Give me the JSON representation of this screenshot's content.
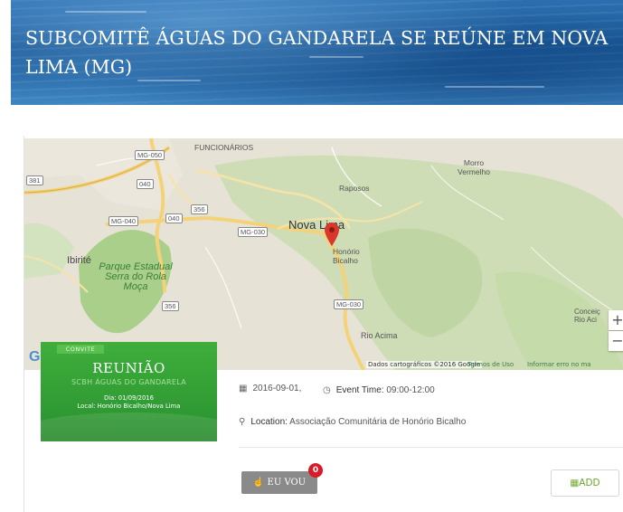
{
  "header": {
    "title": "SUBCOMITÊ ÁGUAS DO GANDARELA SE REÚNE EM NOVA LIMA (MG)"
  },
  "map": {
    "places": {
      "funcionarios": "FUNCIONÁRIOS",
      "morro_vermelho": "Morro Vermelho",
      "raposos": "Raposos",
      "nova_lima": "Nova Lima",
      "honorio_bicalho": "Honório Bicalho",
      "ibirite": "Ibirité",
      "park": "Parque Estadual Serra do Rola Moça",
      "rio_acima": "Rio Acima",
      "conceicao": "Conceiç Rio Aci"
    },
    "shields": {
      "mg050": "MG-050",
      "s381": "381",
      "s040a": "040",
      "s040b": "040",
      "s356a": "356",
      "mg040": "MG-040",
      "mg030": "MG-030",
      "s356b": "356",
      "mg030b": "MG-030"
    },
    "attribution": "Dados cartográficos ©2016 Google",
    "terms": "Termos de Uso",
    "report_error": "Informar erro no ma",
    "google_letter": "G",
    "zoom_in": "+",
    "zoom_out": "−",
    "colors": {
      "park_green": "#a9cf8a",
      "road_yellow": "#f3d27a",
      "marker_red": "#d9372b"
    }
  },
  "invite_card": {
    "tag": "CONVITE",
    "title": "REUNIÃO",
    "subtitle": "SCBH ÁGUAS DO GANDARELA",
    "date_line": "Dia: 01/09/2016",
    "location_line": "Local: Honório Bicalho/Nova Lima"
  },
  "event": {
    "date": "2016-09-01,",
    "time_label": "Event Time:",
    "time_value": "09:00-12:00",
    "location_label": "Location:",
    "location_value": "Associação Comunitária de Honório Bicalho",
    "icons": {
      "date": "calendar-icon",
      "time": "clock-icon",
      "location": "map-pin-icon"
    }
  },
  "actions": {
    "eu_vou_label": "EU VOU",
    "eu_vou_count": "0",
    "add_label": "ADD"
  }
}
